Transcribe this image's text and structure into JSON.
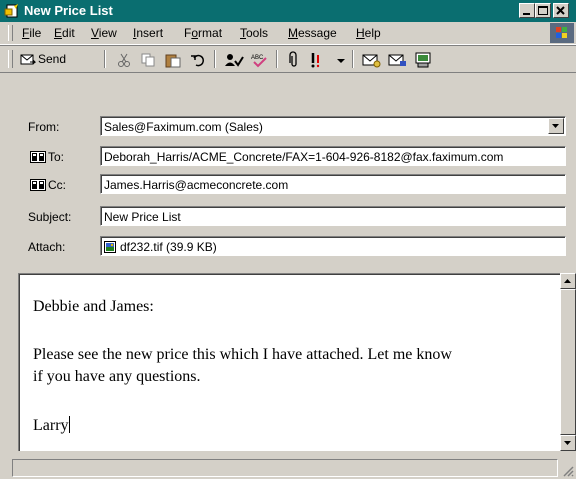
{
  "window": {
    "title": "New Price List"
  },
  "menu": [
    {
      "pre": "",
      "key": "F",
      "post": "ile"
    },
    {
      "pre": "",
      "key": "E",
      "post": "dit"
    },
    {
      "pre": "",
      "key": "V",
      "post": "iew"
    },
    {
      "pre": "",
      "key": "I",
      "post": "nsert"
    },
    {
      "pre": "F",
      "key": "o",
      "post": "rmat"
    },
    {
      "pre": "",
      "key": "T",
      "post": "ools"
    },
    {
      "pre": "",
      "key": "M",
      "post": "essage"
    },
    {
      "pre": "",
      "key": "H",
      "post": "elp"
    }
  ],
  "toolbar": {
    "send_label": "Send"
  },
  "fields": {
    "from_label": "From:",
    "from_value": "Sales@Faximum.com   (Sales)",
    "to_label": "To:",
    "to_value": "Deborah_Harris/ACME_Concrete/FAX=1-604-926-8182@fax.faximum.com",
    "cc_label": "Cc:",
    "cc_value": "James.Harris@acmeconcrete.com",
    "subject_label": "Subject:",
    "subject_value": "New Price List",
    "attach_label": "Attach:",
    "attach_value": "df232.tif (39.9 KB)"
  },
  "message": {
    "greeting": "Debbie and James:",
    "line1": "Please see the new price this which I have attached. Let me know",
    "line2": "if you have any questions.",
    "signature": "Larry"
  },
  "colors": {
    "titlebar": "#0a6e70",
    "chrome": "#d4d0c8"
  }
}
